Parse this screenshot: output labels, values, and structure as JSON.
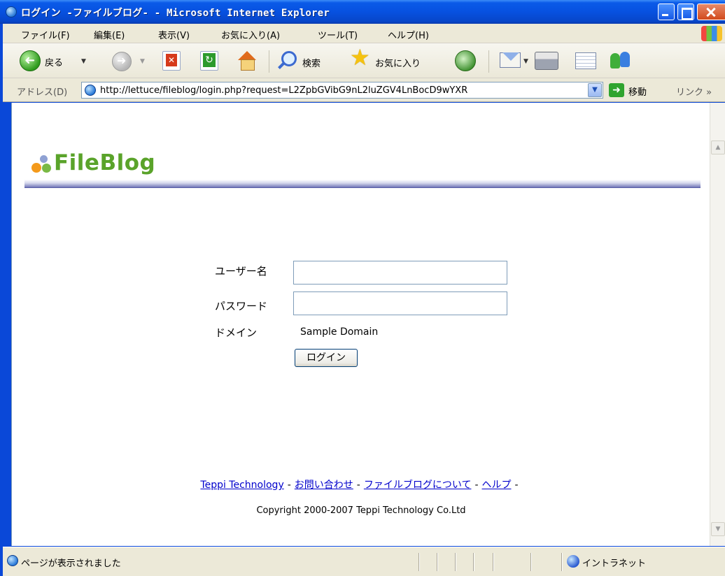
{
  "window": {
    "title": "ログイン -ファイルブログ- - Microsoft Internet Explorer"
  },
  "menubar": {
    "items": [
      "ファイル(F)",
      "編集(E)",
      "表示(V)",
      "お気に入り(A)",
      "ツール(T)",
      "ヘルプ(H)"
    ]
  },
  "toolbar": {
    "back_label": "戻る",
    "search_label": "検索",
    "favorites_label": "お気に入り"
  },
  "addressbar": {
    "label": "アドレス(D)",
    "url": "http://lettuce/fileblog/login.php?request=L2ZpbGVibG9nL2luZGV4LnBocD9wYXR",
    "go_label": "移動",
    "links_label": "リンク »"
  },
  "page": {
    "logo_text": "FileBlog",
    "login": {
      "username_label": "ユーザー名",
      "username_value": "",
      "password_label": "パスワード",
      "password_value": "",
      "domain_label": "ドメイン",
      "domain_value": "Sample Domain",
      "login_button": "ログイン"
    },
    "footer": {
      "links": [
        "Teppi Technology",
        "お問い合わせ",
        "ファイルブログについて",
        "ヘルプ"
      ],
      "separator": "-",
      "copyright": "Copyright 2000-2007 Teppi Technology Co.Ltd"
    }
  },
  "statusbar": {
    "text": "ページが表示されました",
    "zone": "イントラネット"
  },
  "colors": {
    "titlebar": "#0751e0",
    "logo_green": "#5aa32a",
    "link": "#0000cc",
    "chrome": "#ece9d8"
  }
}
